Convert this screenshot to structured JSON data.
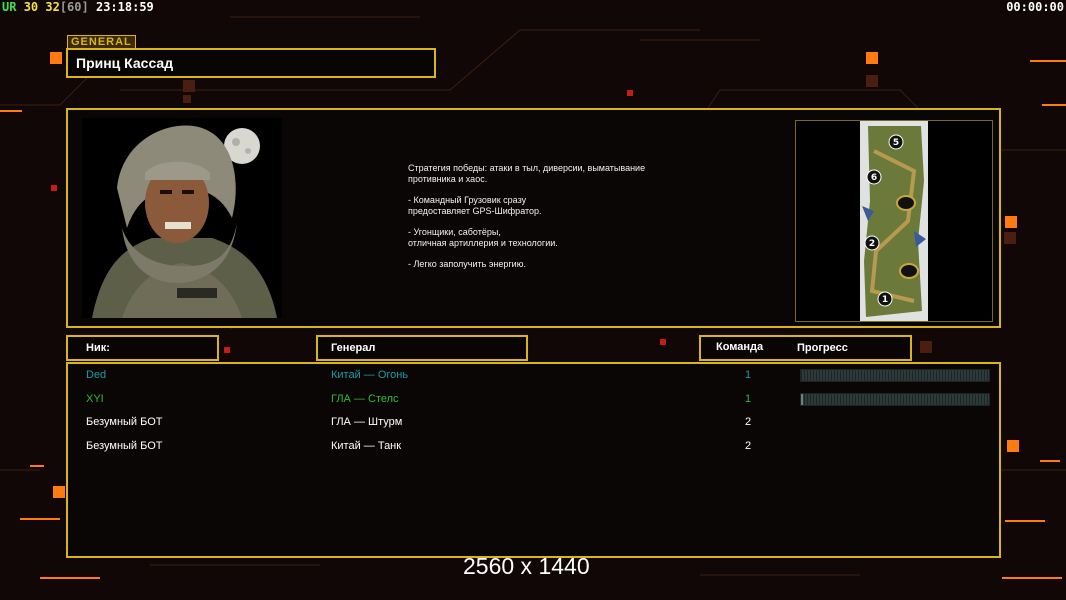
{
  "hud": {
    "ur_label": "UR",
    "fps_a": "30",
    "fps_b": "32",
    "fps_cap": "[60]",
    "clock": "23:18:59",
    "timer": "00:00:00"
  },
  "general": {
    "tag": "GENERAL",
    "name": "Принц Кассад",
    "description": [
      "Стратегия победы: атаки в тыл, диверсии, выматывание\n противника и хаос.",
      "- Командный Грузовик сразу\nпредоставляет GPS-Шифратор.",
      "- Угонщики, саботёры,\nотличная артиллерия и технологии.",
      "- Легко заполучить энергию."
    ]
  },
  "map": {
    "start_positions": [
      "5",
      "6",
      "2",
      "1"
    ]
  },
  "columns": {
    "nick": "Ник:",
    "general": "Генерал",
    "team": "Команда",
    "progress": "Прогресс"
  },
  "players": [
    {
      "nick": "Ded",
      "general": "Китай — Огонь",
      "team": "1",
      "color": "#1f9aa6",
      "progress": 0.0
    },
    {
      "nick": "XYI",
      "general": "ГЛА — Стелс",
      "team": "1",
      "color": "#2fbd2f",
      "progress": 0.01
    },
    {
      "nick": "Безумный БОТ",
      "general": "ГЛА — Штурм",
      "team": "2",
      "color": "#ffffff"
    },
    {
      "nick": "Безумный БОТ",
      "general": "Китай — Танк",
      "team": "2",
      "color": "#ffffff"
    }
  ],
  "overlay": {
    "resolution": "2560 x 1440"
  },
  "colors": {
    "frame": "#d8b51a",
    "accent_orange": "#ff7a10",
    "background": "#120707"
  }
}
